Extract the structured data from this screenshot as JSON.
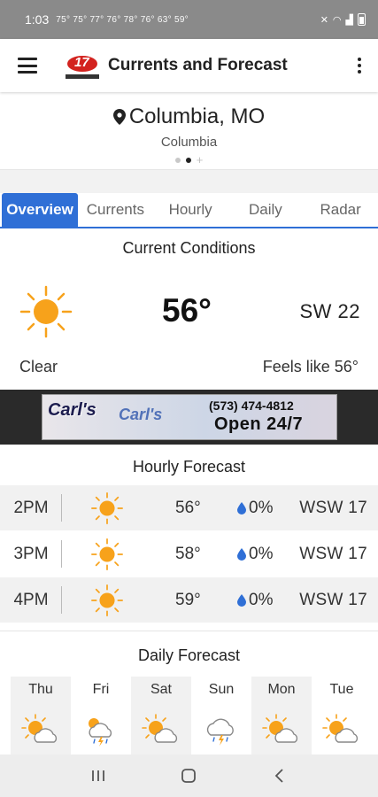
{
  "status_bar": {
    "time": "1:03",
    "temps": "75° 75° 77° 76° 78° 76° 63° 59°"
  },
  "app_bar": {
    "title": "Currents and Forecast"
  },
  "location": {
    "name": "Columbia, MO",
    "subtitle": "Columbia"
  },
  "tabs": [
    {
      "label": "Overview",
      "active": true
    },
    {
      "label": "Currents",
      "active": false
    },
    {
      "label": "Hourly",
      "active": false
    },
    {
      "label": "Daily",
      "active": false
    },
    {
      "label": "Radar",
      "active": false
    }
  ],
  "current_conditions": {
    "title": "Current Conditions",
    "temp": "56°",
    "wind": "SW  22",
    "condition": "Clear",
    "feels_like": "Feels like 56°",
    "icon": "sun-icon"
  },
  "ad": {
    "brand": "Carl's",
    "brand_secondary": "Carl's",
    "phone": "(573) 474-4812",
    "hours": "Open 24/7"
  },
  "hourly": {
    "title": "Hourly Forecast",
    "rows": [
      {
        "time": "2PM",
        "temp": "56°",
        "precip": "0%",
        "wind": "WSW 17",
        "icon": "sun-icon"
      },
      {
        "time": "3PM",
        "temp": "58°",
        "precip": "0%",
        "wind": "WSW 17",
        "icon": "sun-icon"
      },
      {
        "time": "4PM",
        "temp": "59°",
        "precip": "0%",
        "wind": "WSW 17",
        "icon": "sun-icon"
      }
    ]
  },
  "daily": {
    "title": "Daily Forecast",
    "days": [
      {
        "label": "Thu",
        "icon": "partly-cloudy-icon"
      },
      {
        "label": "Fri",
        "icon": "thunderstorm-icon"
      },
      {
        "label": "Sat",
        "icon": "partly-cloudy-icon"
      },
      {
        "label": "Sun",
        "icon": "thunderstorm-icon"
      },
      {
        "label": "Mon",
        "icon": "partly-cloudy-icon"
      },
      {
        "label": "Tue",
        "icon": "partly-cloudy-icon"
      }
    ]
  },
  "colors": {
    "accent": "#2f6fd6",
    "sun": "#f7a21b",
    "drop": "#2f6fd6"
  }
}
